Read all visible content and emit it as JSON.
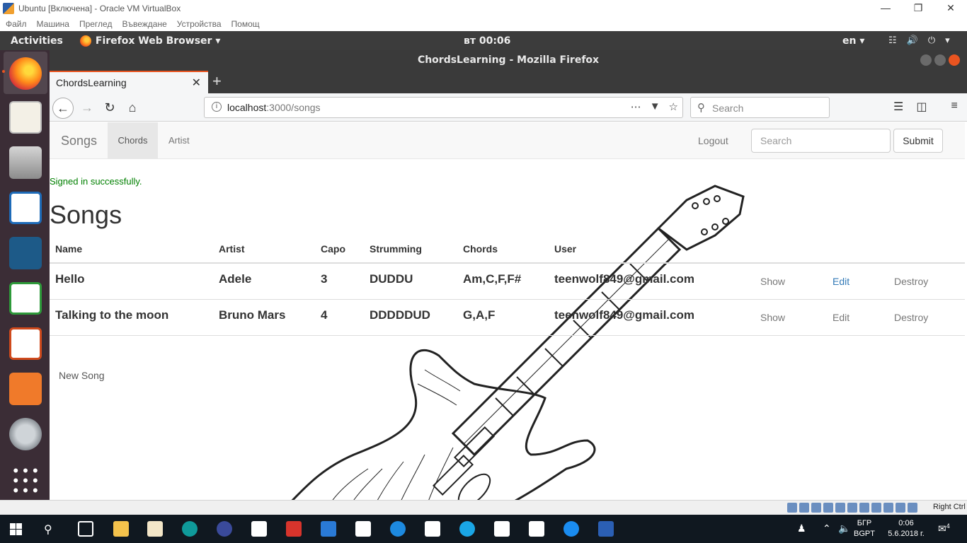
{
  "vbox": {
    "title": "Ubuntu [Включена] - Oracle VM VirtualBox",
    "menu": [
      "Файл",
      "Машина",
      "Преглед",
      "Въвеждане",
      "Устройства",
      "Помощ"
    ],
    "host_key": "Right Ctrl"
  },
  "ubuntu_topbar": {
    "activities": "Activities",
    "app_menu": "Firefox Web Browser ▾",
    "clock": "вт 00:06",
    "language": "en ▾"
  },
  "firefox": {
    "window_title": "ChordsLearning - Mozilla Firefox",
    "tab_title": "ChordsLearning",
    "url_host": "localhost",
    "url_path": ":3000/songs",
    "search_placeholder": "Search"
  },
  "page": {
    "brand": "Songs",
    "nav_chords": "Chords",
    "nav_artist": "Artist",
    "logout": "Logout",
    "search_placeholder": "Search",
    "submit": "Submit",
    "notice": "Signed in successfully.",
    "title": "Songs",
    "new_song": "New Song",
    "columns": [
      "Name",
      "Artist",
      "Capo",
      "Strumming",
      "Chords",
      "User"
    ],
    "rows": [
      {
        "name": "Hello",
        "artist": "Adele",
        "capo": "3",
        "strumming": "DUDDU",
        "chords": "Am,C,F,F#",
        "user": "teenwolf849@gmail.com",
        "show": "Show",
        "edit": "Edit",
        "destroy": "Destroy"
      },
      {
        "name": "Talking to the moon",
        "artist": "Bruno Mars",
        "capo": "4",
        "strumming": "DDDDDUD",
        "chords": "G,A,F",
        "user": "teenwolf849@gmail.com",
        "show": "Show",
        "edit": "Edit",
        "destroy": "Destroy"
      }
    ]
  },
  "taskbar": {
    "language_top": "БГР",
    "language_bottom": "BGPT",
    "time": "0:06",
    "date": "5.6.2018 г.",
    "notifications": "4"
  },
  "icons": {
    "dock": [
      "firefox-icon",
      "text-editor-icon",
      "files-icon",
      "writer-icon",
      "mysql-workbench-icon",
      "calc-icon",
      "impress-icon",
      "software-center-icon",
      "settings-icon",
      "app-grid-icon"
    ]
  },
  "colors": {
    "ubuntu_orange": "#e95420",
    "link_blue": "#337ab7",
    "notice_green": "#008000"
  }
}
